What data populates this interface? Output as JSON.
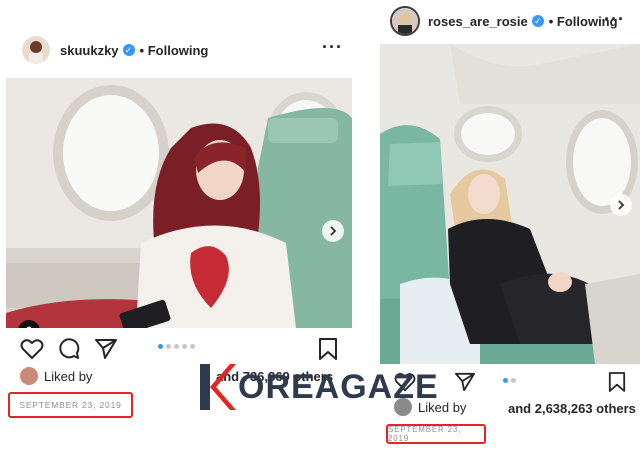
{
  "left_post": {
    "username": "skuukzky",
    "following_label": "• Following",
    "liked_by_label": "Liked by",
    "others_label": "and 736,869 others",
    "date": "SEPTEMBER 23, 2019"
  },
  "right_post": {
    "username": "roses_are_rosie",
    "following_label": "• Following",
    "liked_by_label": "Liked by",
    "others_label": "and 2,638,263 others",
    "date": "SEPTEMBER 23, 2019"
  },
  "watermark": {
    "text": "OREAGAZE",
    "brand_color": "#e52424"
  },
  "colors": {
    "verified": "#3897f0",
    "highlight": "#e52424",
    "seat": "#7fb9a6"
  },
  "icons": [
    "heart-icon",
    "comment-icon",
    "share-icon",
    "bookmark-icon",
    "more-icon",
    "chevron-right-icon",
    "user-tag-icon",
    "verified-icon"
  ]
}
